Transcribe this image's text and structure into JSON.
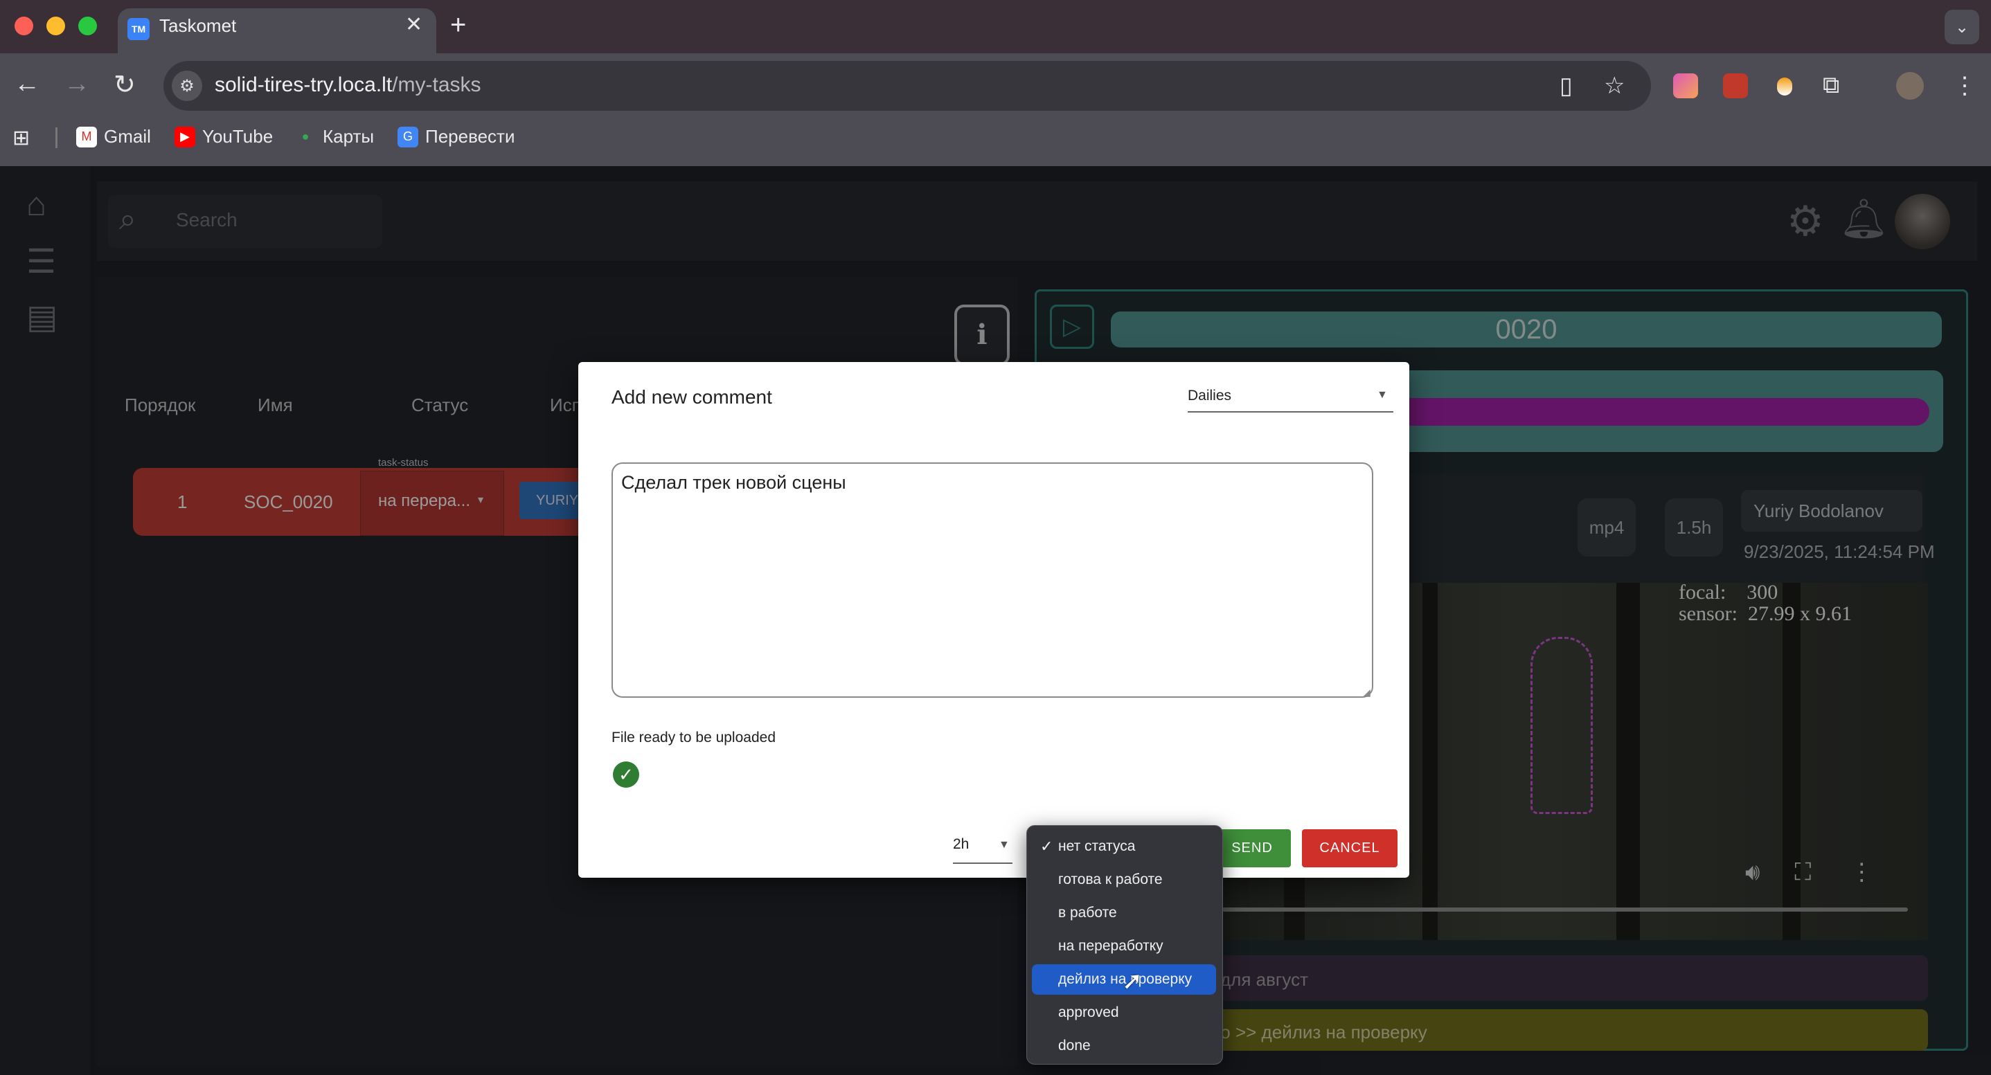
{
  "browser": {
    "tab_title": "Taskomet",
    "tab_favicon": "TM",
    "url_host": "solid-tires-try.loca.lt",
    "url_path": "/my-tasks",
    "bookmarks": [
      {
        "label": "Gmail",
        "icon": "gmail-icon"
      },
      {
        "label": "YouTube",
        "icon": "youtube-icon"
      },
      {
        "label": "Карты",
        "icon": "maps-icon"
      },
      {
        "label": "Перевести",
        "icon": "translate-icon"
      }
    ]
  },
  "app": {
    "search_placeholder": "Search",
    "table_headers": [
      "Порядок",
      "Имя",
      "Статус",
      "Исп"
    ],
    "row": {
      "order": "1",
      "name": "SOC_0020",
      "status_label": "task-status",
      "status": "на перера...",
      "assignee": "YURIY"
    },
    "shot_code": "0020",
    "version": {
      "format": "mp4",
      "duration": "1.5h",
      "author": "Yuriy Bodolanov",
      "date": "9/23/2025, 11:24:54 PM"
    },
    "video_hud": "focal:    300\nsensor:  27.99 x 9.61",
    "comments": [
      {
        "text": "для август"
      },
      {
        "text": "nged to >> дейлиз на проверку"
      }
    ]
  },
  "modal": {
    "title": "Add new comment",
    "category": "Dailies",
    "comment_text": "Сделал трек новой сцены",
    "file_status": "File ready to be uploaded",
    "time_value": "2h",
    "send_label": "SEND",
    "cancel_label": "CANCEL"
  },
  "status_dropdown": {
    "options": [
      {
        "label": "нет статуса",
        "checked": true
      },
      {
        "label": "готова к работе"
      },
      {
        "label": "в работе"
      },
      {
        "label": "на переработку"
      },
      {
        "label": "дейлиз на проверку",
        "highlighted": true
      },
      {
        "label": "approved"
      },
      {
        "label": "done"
      }
    ]
  },
  "colors": {
    "row_red": "#b53a33",
    "accent_teal": "#4c8a87",
    "send_green": "#3e8e3a",
    "cancel_red": "#d0302a",
    "highlight_blue": "#1f5cc7"
  }
}
